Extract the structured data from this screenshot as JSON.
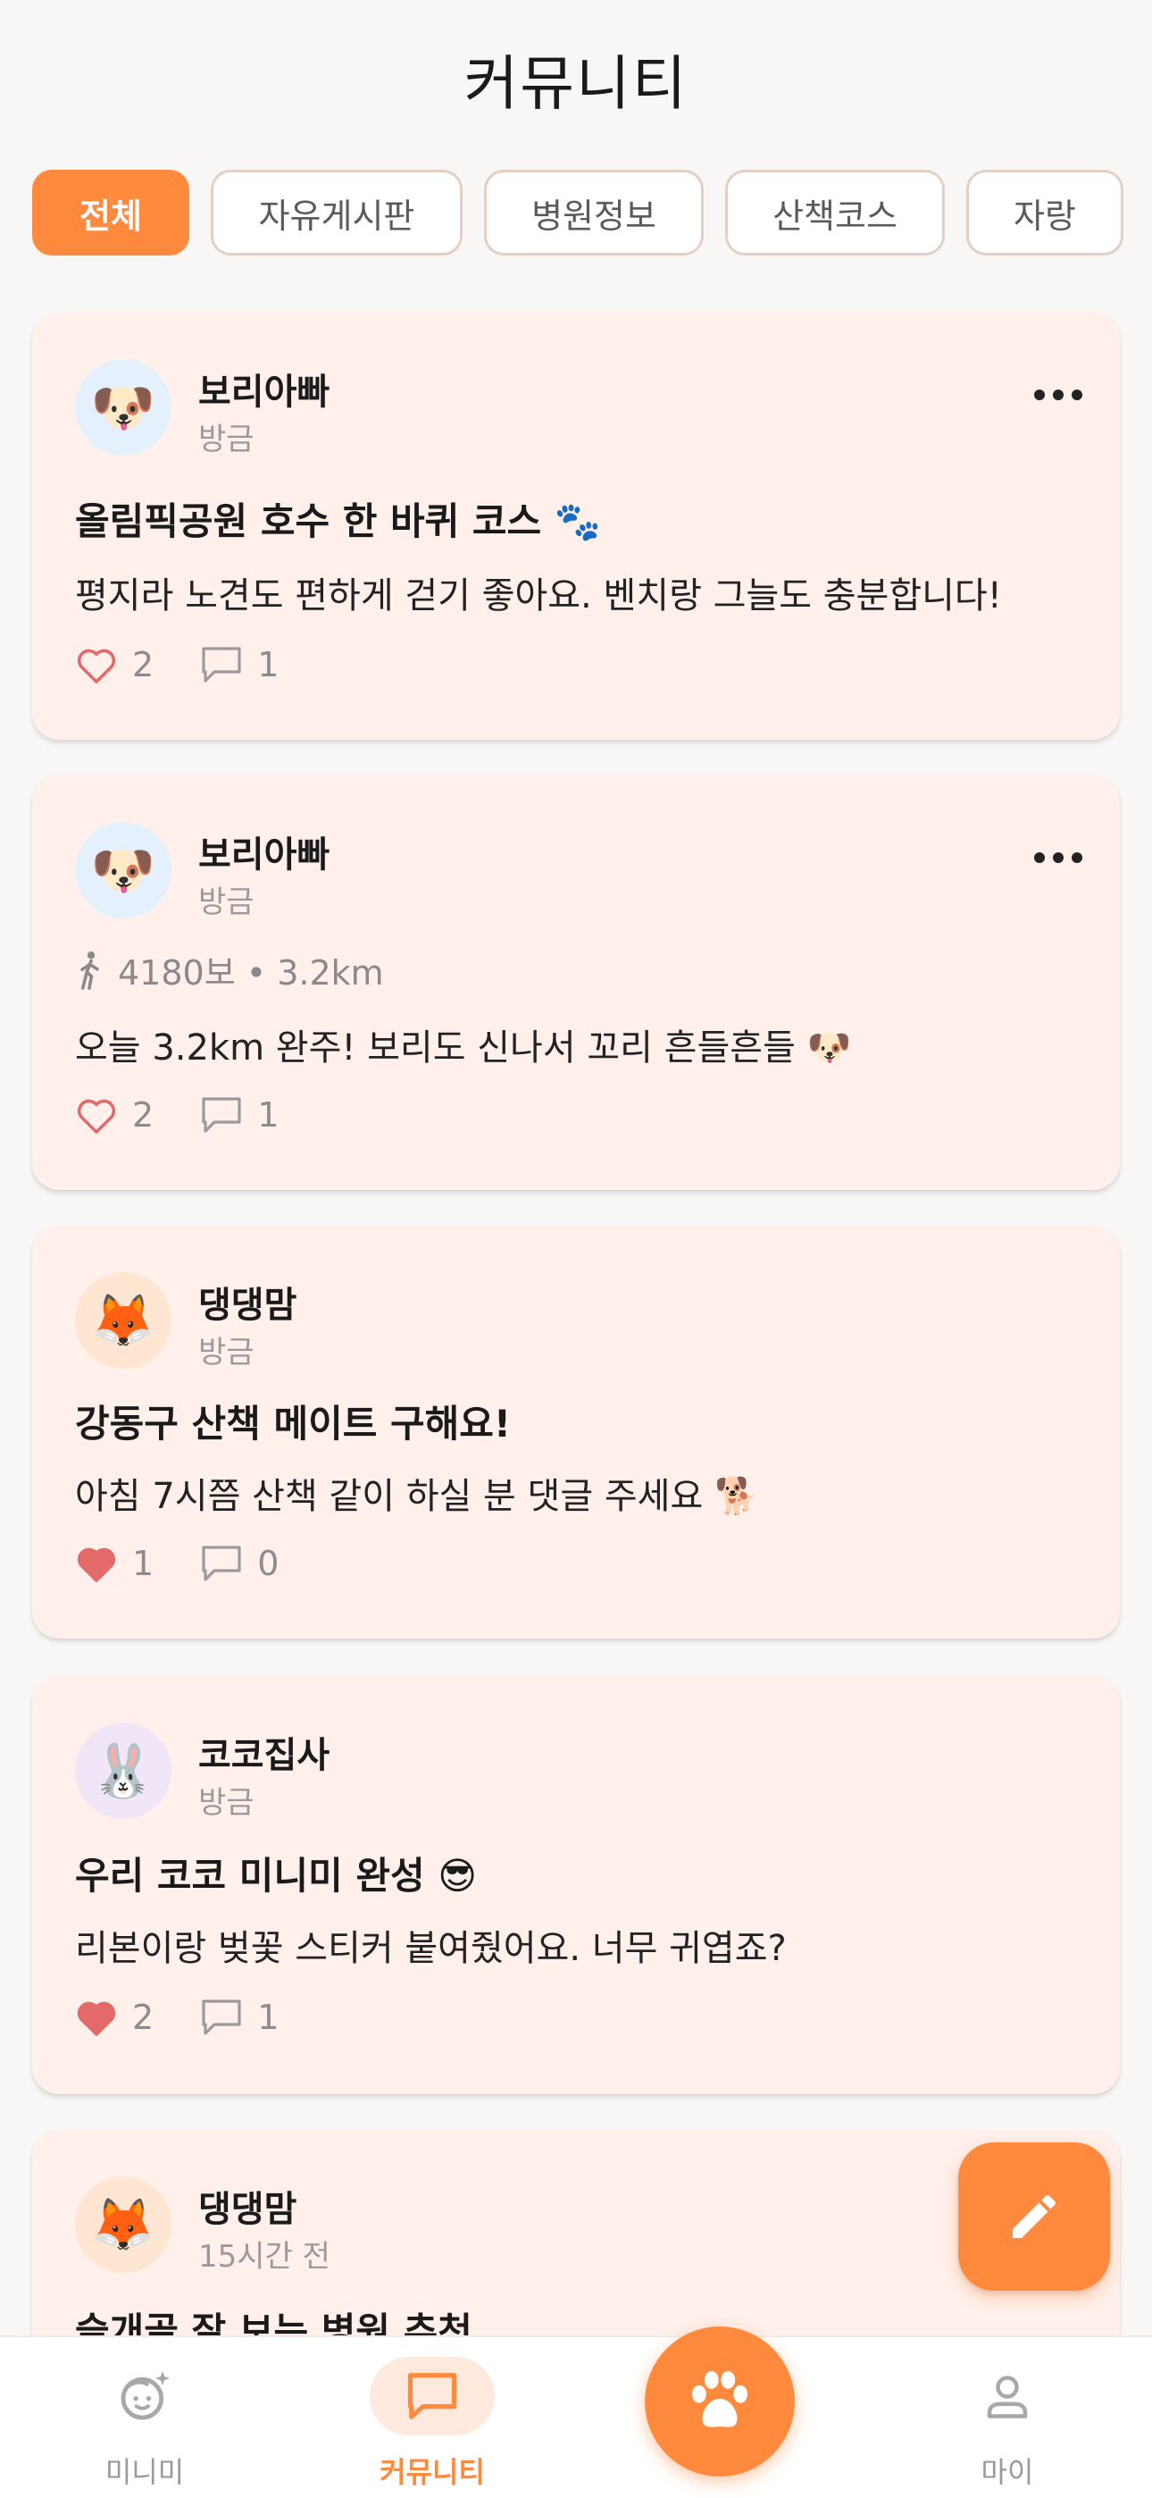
{
  "header": {
    "title": "커뮤니티"
  },
  "chips": [
    {
      "label": "전체",
      "active": true
    },
    {
      "label": "자유게시판",
      "active": false
    },
    {
      "label": "병원정보",
      "active": false
    },
    {
      "label": "산책코스",
      "active": false
    },
    {
      "label": "자랑",
      "active": false
    }
  ],
  "posts": [
    {
      "author": "보리아빠",
      "time": "방금",
      "avatar": "🐶",
      "avatar_bg": "#E4F1FD",
      "title": "올림픽공원 호수 한 바퀴 코스 🐾",
      "body": "평지라 노견도 편하게 걷기 좋아요. 벤치랑 그늘도 충분합니다!",
      "likes": "2",
      "comments": "1",
      "liked": false,
      "has_menu": true
    },
    {
      "author": "보리아빠",
      "time": "방금",
      "avatar": "🐶",
      "avatar_bg": "#E4F1FD",
      "walk": "4180보 • 3.2km",
      "body": "오늘 3.2km 완주! 보리도 신나서 꼬리 흔들흔들 🐶",
      "likes": "2",
      "comments": "1",
      "liked": false,
      "has_menu": true
    },
    {
      "author": "댕댕맘",
      "time": "방금",
      "avatar": "🦊",
      "avatar_bg": "#FFE6D2",
      "title": "강동구 산책 메이트 구해요!",
      "body": "아침 7시쯤 산책 같이 하실 분 댓글 주세요 🐕",
      "likes": "1",
      "comments": "0",
      "liked": true,
      "has_menu": false
    },
    {
      "author": "코코집사",
      "time": "방금",
      "avatar": "🐰",
      "avatar_bg": "#F1E6F7",
      "title": "우리 코코 미니미 완성 😎",
      "body": "리본이랑 벚꽃 스티커 붙여줬어요. 너무 귀엽죠?",
      "likes": "2",
      "comments": "1",
      "liked": true,
      "has_menu": false
    },
    {
      "author": "댕댕맘",
      "time": "15시간 전",
      "avatar": "🦊",
      "avatar_bg": "#FFE6D2",
      "title": "슬개골 잘 보는 병원 추천"
    }
  ],
  "nav": {
    "items": [
      {
        "label": "미니미",
        "icon": "face-sparkle-icon"
      },
      {
        "label": "커뮤니티",
        "icon": "chat-bubble-icon"
      },
      {
        "label": "",
        "icon": "paw-icon"
      },
      {
        "label": "마이",
        "icon": "person-icon"
      }
    ]
  },
  "fab": {
    "icon": "pencil-icon"
  },
  "colors": {
    "accent": "#FF8A3D",
    "card_bg": "#FFF0EB",
    "heart": "#E46A6A"
  }
}
